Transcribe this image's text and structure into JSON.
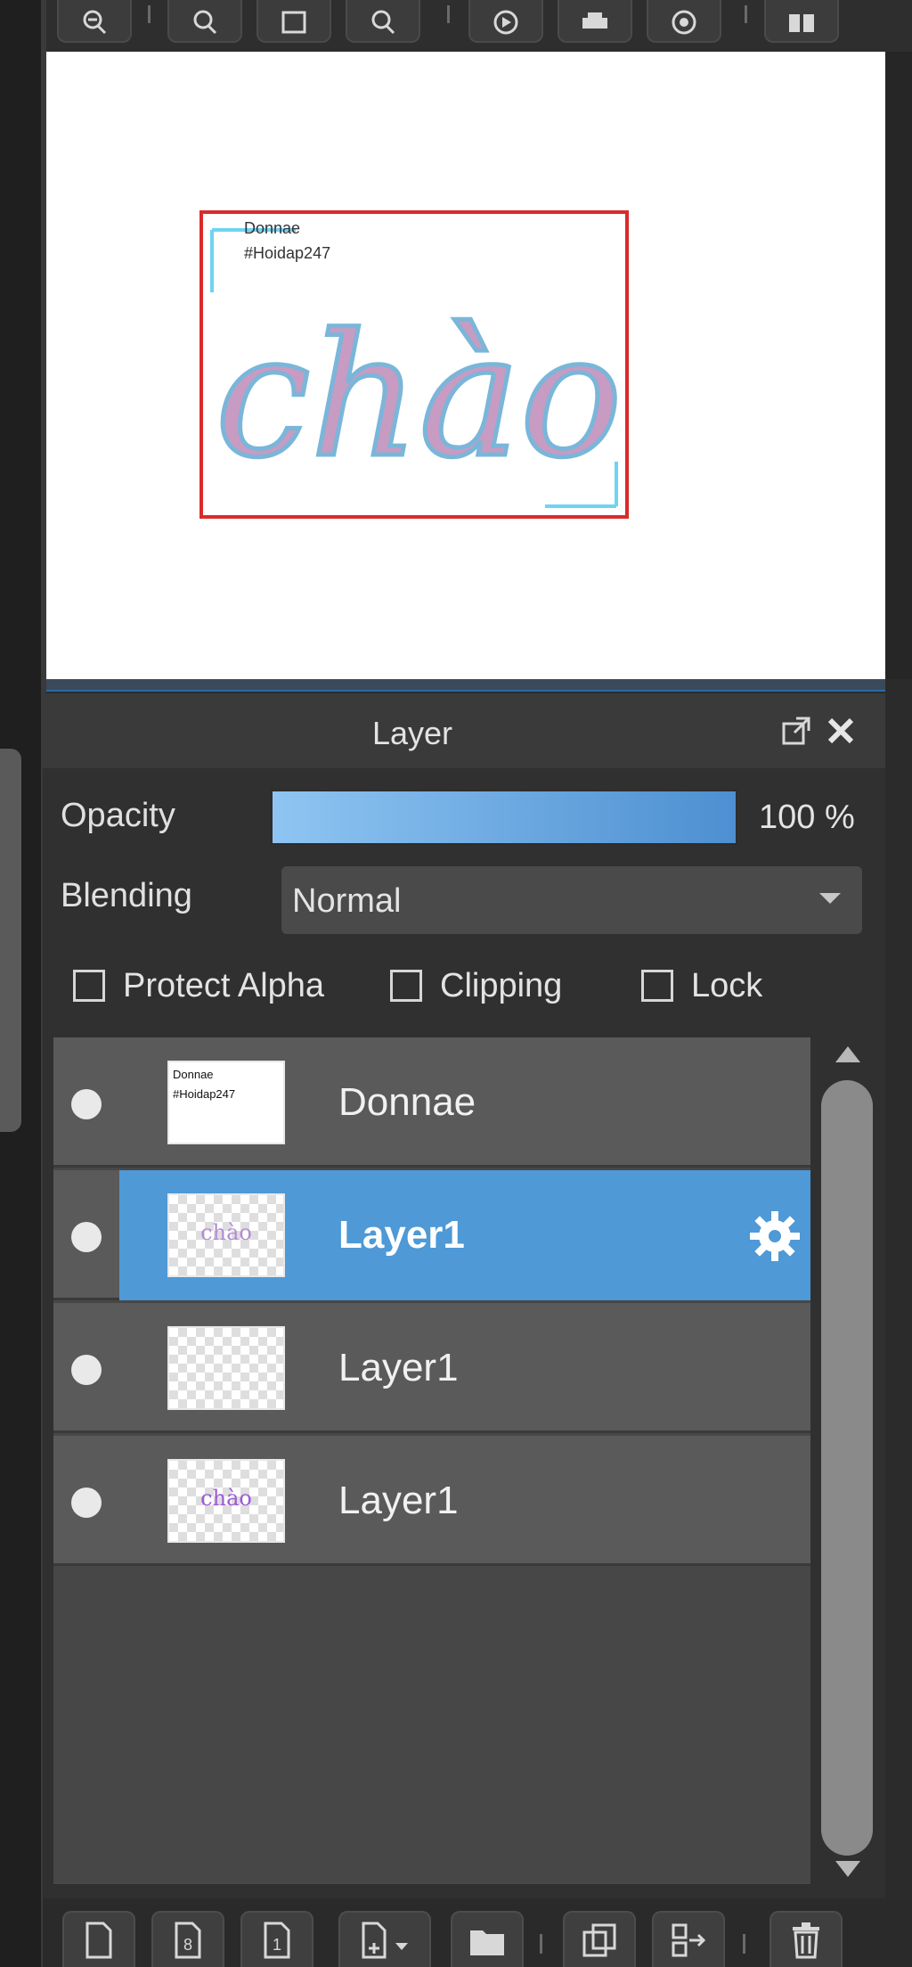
{
  "colors": {
    "accent": "#4e99d6",
    "frame_red": "#d92b2b",
    "guide_cyan": "#6fd3f2"
  },
  "toolbar_top": {
    "icons": [
      "zoom-in-icon",
      "zoom-out-icon",
      "fit-screen-icon",
      "search-icon",
      "rotate-icon",
      "print-icon",
      "compass-icon",
      "layout-icon"
    ]
  },
  "canvas": {
    "text_line1": "Donnae",
    "text_line2": "#Hoidap247",
    "lettering": "chào"
  },
  "layer_panel": {
    "title": "Layer",
    "opacity_label": "Opacity",
    "opacity_value": "100 %",
    "opacity_fraction": 1.0,
    "blending_label": "Blending",
    "blending_value": "Normal",
    "protect_alpha_label": "Protect Alpha",
    "clipping_label": "Clipping",
    "lock_label": "Lock",
    "layers": [
      {
        "name": "Donnae",
        "thumb_line1": "Donnae",
        "thumb_line2": "#Hoidap247",
        "selected": false
      },
      {
        "name": "Layer1",
        "thumb_text": "chào",
        "selected": true
      },
      {
        "name": "Layer1",
        "thumb_text": "",
        "selected": false
      },
      {
        "name": "Layer1",
        "thumb_text": "chào",
        "selected": false
      }
    ]
  },
  "bottom_bar": {
    "icons": [
      "new-layer-icon",
      "new-8bit-layer-icon",
      "new-1bit-layer-icon",
      "add-layer-menu-icon",
      "new-folder-icon",
      "duplicate-layer-icon",
      "merge-layer-icon",
      "delete-layer-icon"
    ]
  }
}
